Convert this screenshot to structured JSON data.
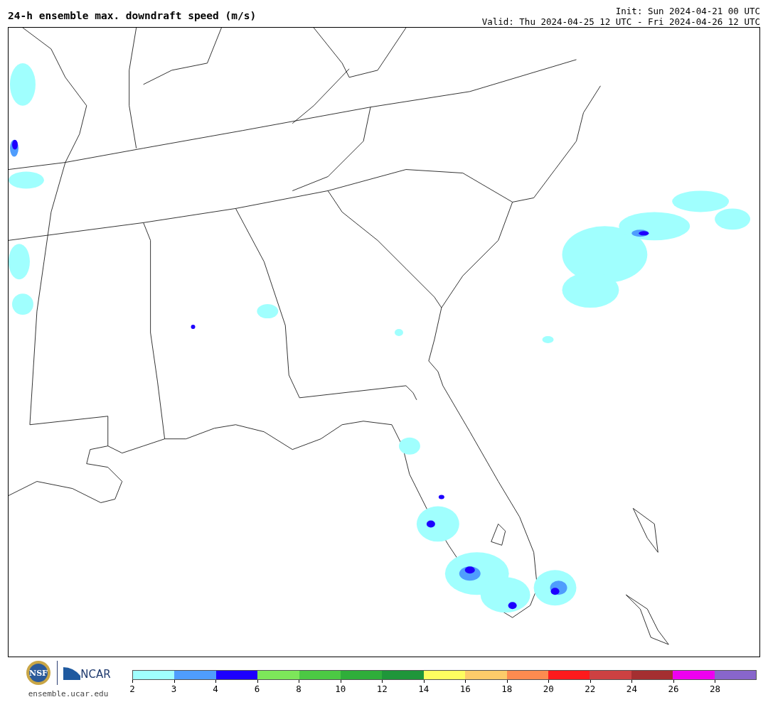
{
  "title": "24-h ensemble max. downdraft speed (m/s)",
  "init": "Init: Sun 2024-04-21 00 UTC",
  "valid": "Valid: Thu 2024-04-25 12 UTC - Fri 2024-04-26 12 UTC",
  "logos": {
    "nsf": "NSF",
    "ncar": "NCAR"
  },
  "site": "ensemble.ucar.edu",
  "colorbar": {
    "bins": [
      {
        "color": "#a0fffe"
      },
      {
        "color": "#4f9dfd"
      },
      {
        "color": "#1d00fe"
      },
      {
        "color": "#7de65a"
      },
      {
        "color": "#4cc944"
      },
      {
        "color": "#2fae3a"
      },
      {
        "color": "#1f963a"
      },
      {
        "color": "#fefe60"
      },
      {
        "color": "#fdcc6a"
      },
      {
        "color": "#fd8b50"
      },
      {
        "color": "#fd1a1d"
      },
      {
        "color": "#cd4142"
      },
      {
        "color": "#a42f31"
      },
      {
        "color": "#ef00f0"
      },
      {
        "color": "#8866cc"
      }
    ],
    "ticks": [
      "2",
      "3",
      "4",
      "6",
      "8",
      "10",
      "12",
      "14",
      "16",
      "18",
      "20",
      "22",
      "24",
      "26",
      "28"
    ]
  }
}
